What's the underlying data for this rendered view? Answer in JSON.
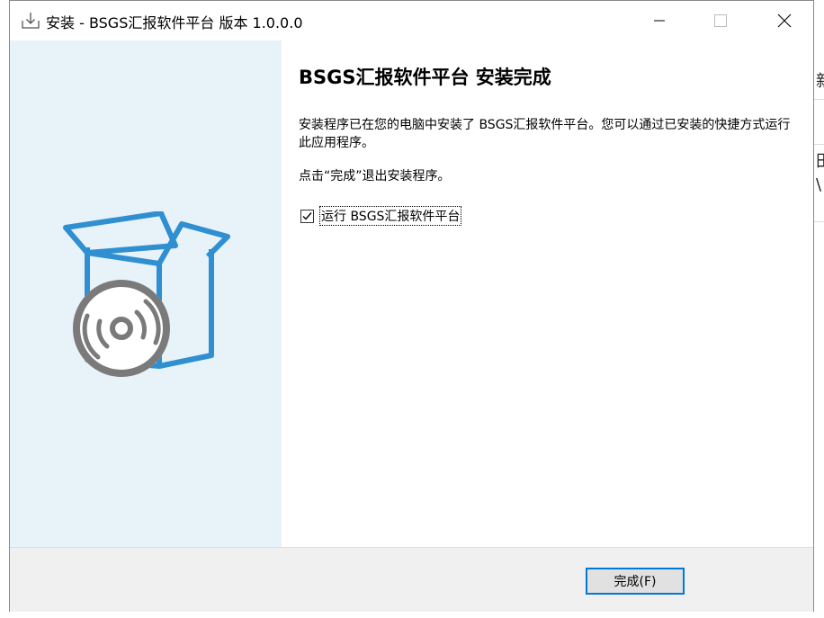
{
  "window": {
    "title": "安装 - BSGS汇报软件平台 版本 1.0.0.0"
  },
  "captions": {
    "minimize": "minimize-icon",
    "maximize": "maximize-icon",
    "close": "close-icon"
  },
  "content": {
    "heading": "BSGS汇报软件平台 安装完成",
    "description": "安装程序已在您的电脑中安装了 BSGS汇报软件平台。您可以通过已安装的快捷方式运行此应用程序。",
    "hint": "点击“完成”退出安装程序。",
    "run_checkbox": {
      "label": "运行 BSGS汇报软件平台",
      "checked": true
    }
  },
  "footer": {
    "finish_label": "完成(F)"
  },
  "background_window": {
    "glyphs": [
      "新",
      "田",
      "\\"
    ]
  },
  "colors": {
    "sidebar_bg": "#e8f2f9",
    "accent": "#0078d7",
    "box_blue": "#2f8fd0",
    "disc_gray": "#7a7a7a"
  },
  "icons": {
    "app": "installer-download-icon",
    "illustration": "software-box-disc-icon"
  }
}
